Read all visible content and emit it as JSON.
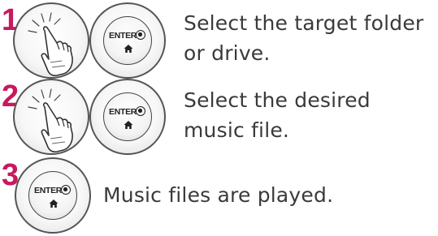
{
  "steps": [
    {
      "number": "1",
      "line1": "Select the target folder",
      "line2": "or drive."
    },
    {
      "number": "2",
      "line1": "Select the desired",
      "line2": "music file."
    },
    {
      "number": "3",
      "line1": "Music files are played."
    }
  ],
  "button": {
    "label": "ENTER"
  },
  "icons": {
    "hand": "hand-pointer-icon",
    "home": "home-icon",
    "enter_mark": "enter-circle-icon"
  },
  "colors": {
    "step_number": "#c8195e",
    "text": "#3a3a3a"
  }
}
